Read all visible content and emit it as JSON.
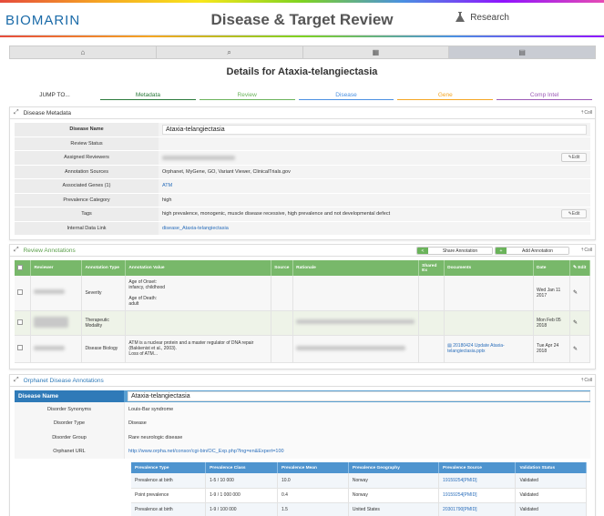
{
  "app": {
    "brand": "BIOMARIN",
    "title": "Disease & Target Review",
    "research_label": "Research"
  },
  "nav": {
    "icons": [
      "home-icon",
      "search-icon",
      "table-icon",
      "list-icon"
    ]
  },
  "page_title": "Details for Ataxia-telangiectasia",
  "jump": {
    "label": "JUMP TO...",
    "items": [
      {
        "label": "Metadata",
        "color": "#2b7a3b"
      },
      {
        "label": "Review",
        "color": "#6ab35a"
      },
      {
        "label": "Disease",
        "color": "#4a90e2"
      },
      {
        "label": "Gene",
        "color": "#f5a623"
      },
      {
        "label": "Comp Intel",
        "color": "#9b59b6"
      }
    ]
  },
  "metadata": {
    "title": "Disease Metadata",
    "collapse": "Coll",
    "edit_label": "Edit",
    "rows": {
      "disease_name": {
        "k": "Disease Name",
        "v": "Ataxia-telangiectasia"
      },
      "review_status": {
        "k": "Review Status",
        "v": ""
      },
      "assigned": {
        "k": "Assigned Reviewers"
      },
      "annotation_sources": {
        "k": "Annotation Sources",
        "v": "Orphanet, MyGene, GO, Variant Viewer, ClinicalTrials.gov"
      },
      "genes": {
        "k": "Associated Genes (1)",
        "v": "ATM"
      },
      "prevalence": {
        "k": "Prevalence Category",
        "v": "high"
      },
      "tags": {
        "k": "Tags",
        "v": "high prevalence, monogenic, muscle disease recessive, high prevalence and not developmental defect"
      },
      "link": {
        "k": "Internal Data Link",
        "v": "disease_Ataxia-telangiectasia"
      }
    }
  },
  "review": {
    "title": "Review Annotations",
    "collapse": "Coll",
    "share_label": "Share Annotation",
    "add_label": "Add Annotation",
    "headers": [
      "Reviewer",
      "Annotation Type",
      "Annotation Value",
      "Source",
      "Rationale",
      "Shared Ex",
      "Documents",
      "Date",
      "Edit"
    ],
    "rows": [
      {
        "type": "Severity",
        "value": "Age of Onset:\ninfancy, childhood\n\nAge of Death:\nadult",
        "doc": "",
        "date": "Wed Jan 11 2017"
      },
      {
        "type": "Therapeutic Modality",
        "value": "",
        "doc": "",
        "date": "Mon Feb 05 2018"
      },
      {
        "type": "Disease Biology",
        "value": "ATM is a nuclear protein and a master regulator of DNA repair (Bakkenist et al., 2003).\nLoss of ATM...",
        "doc": "20180424 Update Ataxia-telangiectasia.pptx",
        "date": "Tue Apr 24 2018"
      }
    ]
  },
  "orphanet": {
    "title": "Orphanet Disease Annotations",
    "collapse": "Coll",
    "disease_name_label": "Disease Name",
    "disease_name": "Ataxia-telangiectasia",
    "rows": {
      "synonyms": {
        "k": "Disorder Synonyms",
        "v": "Louis-Bar syndrome"
      },
      "type": {
        "k": "Disorder Type",
        "v": "Disease"
      },
      "group": {
        "k": "Disorder Group",
        "v": "Rare neurologic disease"
      },
      "url": {
        "k": "Orphanet URL",
        "v": "http://www.orpha.net/consor/cgi-bin/OC_Exp.php?lng=en&Expert=100"
      }
    },
    "prev_headers": [
      "Prevalence Type",
      "Prevalence Class",
      "Prevalence Mean",
      "Prevalence Geography",
      "Prevalence Source",
      "Validation Status"
    ],
    "prev_rows": [
      [
        "Prevalence at birth",
        "1-5 / 10 000",
        "10.0",
        "Norway",
        "19159254[PMID]",
        "Validated"
      ],
      [
        "Point prevalence",
        "1-9 / 1 000 000",
        "0.4",
        "Norway",
        "19159254[PMID]",
        "Validated"
      ],
      [
        "Prevalence at birth",
        "1-9 / 100 000",
        "1.5",
        "United States",
        "20301790[PMID]",
        "Validated"
      ]
    ]
  }
}
